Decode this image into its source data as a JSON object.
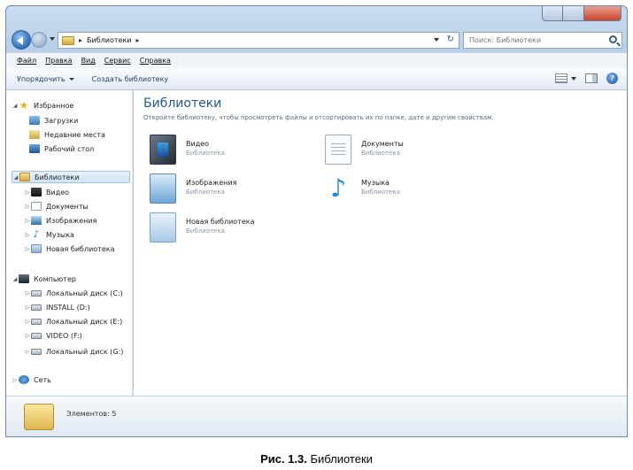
{
  "address": {
    "path": "Библиотеки",
    "sep": "▸",
    "end_sep": "▸",
    "refresh": "↻"
  },
  "search": {
    "placeholder": "Поиск: Библиотеки"
  },
  "menu": [
    "Файл",
    "Правка",
    "Вид",
    "Сервис",
    "Справка"
  ],
  "commands": {
    "organize": "Упорядочить",
    "new_library": "Создать библиотеку",
    "help": "?"
  },
  "nav": {
    "favorites": "Избранное",
    "downloads": "Загрузки",
    "recent": "Недавние места",
    "desktop": "Рабочий стол",
    "libraries": "Библиотеки",
    "lib_video": "Видео",
    "lib_docs": "Документы",
    "lib_images": "Изображения",
    "lib_music": "Музыка",
    "lib_new": "Новая библиотека",
    "computer": "Компьютер",
    "disk_c": "Локальный диск (C:)",
    "disk_d": "INSTALL (D:)",
    "disk_e": "Локальный диск (E:)",
    "disk_f": "VIDEO (F:)",
    "disk_g": "Локальный диск (G:)",
    "network": "Сеть"
  },
  "content": {
    "title": "Библиотеки",
    "description": "Откройте библиотеку, чтобы просмотреть файлы и отсортировать их по папке, дате и другим свойствам.",
    "items": [
      {
        "name": "Видео",
        "type": "Библиотека"
      },
      {
        "name": "Документы",
        "type": "Библиотека"
      },
      {
        "name": "Изображения",
        "type": "Библиотека"
      },
      {
        "name": "Музыка",
        "type": "Библиотека"
      },
      {
        "name": "Новая библиотека",
        "type": "Библиотека"
      }
    ]
  },
  "details": {
    "count_text": "Элементов: 5"
  },
  "caption": {
    "label": "Рис. 1.3.",
    "text": " Библиотеки"
  },
  "colors": {
    "title_blue": "#1f5a96",
    "selection": "#cfe3f8"
  }
}
